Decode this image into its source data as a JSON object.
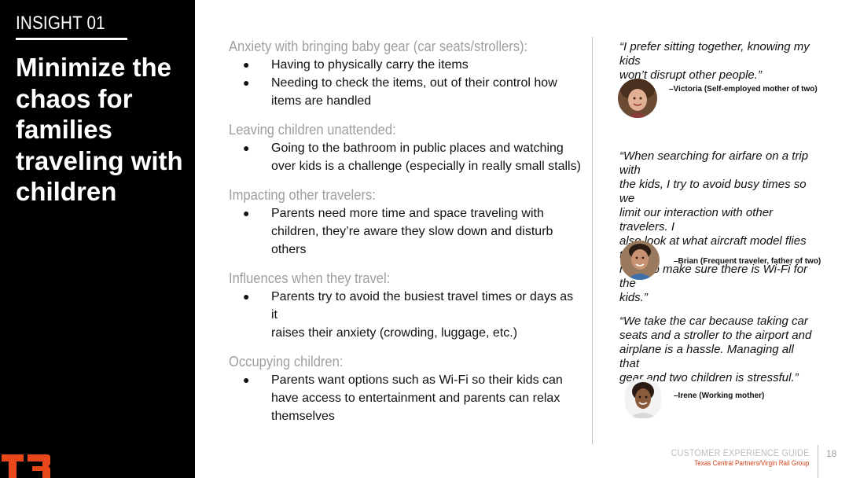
{
  "sidebar": {
    "insight_label": "INSIGHT 01",
    "headline_lines": [
      "Minimize the",
      "chaos for",
      "families",
      "traveling with",
      "children"
    ],
    "logo_text": "T3",
    "logo_color": "#e8471b"
  },
  "sections": [
    {
      "title": "Anxiety with bringing baby gear (car seats/strollers):",
      "bullets": [
        [
          "Having to physically carry the items"
        ],
        [
          "Needing to check the items, out of their control how",
          "items are handled"
        ]
      ]
    },
    {
      "title": "Leaving children unattended:",
      "bullets": [
        [
          "Going to the bathroom in public places and watching",
          "over kids is a challenge (especially in really small stalls)"
        ]
      ]
    },
    {
      "title": "Impacting other travelers:",
      "bullets": [
        [
          "Parents need more time and space traveling with",
          "children, they’re aware they slow down and disturb",
          "others"
        ]
      ]
    },
    {
      "title": "Influences when they travel:",
      "bullets": [
        [
          "Parents try to avoid the busiest travel times or days as it",
          "raises their anxiety (crowding, luggage, etc.)"
        ]
      ]
    },
    {
      "title": "Occupying children:",
      "bullets": [
        [
          "Parents want options such as Wi-Fi so their kids can",
          "have access to entertainment and parents can relax",
          "themselves"
        ]
      ]
    }
  ],
  "bullet_glyph": "●",
  "quotes": [
    {
      "lines": [
        "“I prefer sitting together, knowing my kids",
        "won’t disrupt other people.”"
      ],
      "attribution": "–Victoria (Self-employed mother of two)"
    },
    {
      "lines": [
        "“When searching for airfare on a trip with",
        "the kids, I try to avoid busy times so we",
        "limit our interaction with other travelers. I",
        "also look at what aircraft model flies that",
        "route to make sure there is Wi-Fi for the",
        "kids.”"
      ],
      "attribution": "–Brian (Frequent traveler, father of two)"
    },
    {
      "lines": [
        "“We take the car because taking car",
        "seats and a stroller to the airport and",
        "airplane is a hassle. Managing all that",
        "gear and two children is stressful.”"
      ],
      "attribution": "–Irene (Working mother)"
    }
  ],
  "footer": {
    "guide": "CUSTOMER EXPERIENCE GUIDE",
    "subtitle": "Texas Central Partners/Virgin Rail Group",
    "subtitle_color": "#d0431c",
    "page_number": "18"
  }
}
